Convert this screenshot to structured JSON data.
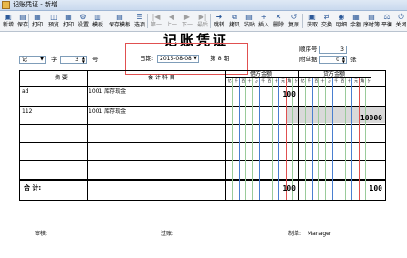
{
  "window": {
    "title": "记账凭证 - 新增"
  },
  "toolbar": {
    "buttons": [
      {
        "label": "新增",
        "icon": "new-icon",
        "glyph": "▣",
        "enabled": true
      },
      {
        "label": "保存",
        "icon": "save-icon",
        "glyph": "▤",
        "enabled": true
      },
      {
        "label": "打印",
        "icon": "print-icon",
        "glyph": "▦",
        "enabled": true
      },
      {
        "label": "预览",
        "icon": "preview-icon",
        "glyph": "◫",
        "enabled": true
      },
      {
        "label": "打印",
        "icon": "print2-icon",
        "glyph": "▦",
        "enabled": true
      },
      {
        "label": "设置",
        "icon": "settings-icon",
        "glyph": "⚙",
        "enabled": true
      },
      {
        "label": "模板",
        "icon": "template-icon",
        "glyph": "▥",
        "enabled": true
      },
      {
        "label": "保存模板",
        "icon": "save-template-icon",
        "glyph": "▤",
        "enabled": true
      },
      {
        "label": "选项",
        "icon": "options-icon",
        "glyph": "☰",
        "enabled": true
      },
      {
        "label": "第一",
        "icon": "first-icon",
        "glyph": "|◀",
        "enabled": false
      },
      {
        "label": "上一",
        "icon": "prev-icon",
        "glyph": "◀",
        "enabled": false
      },
      {
        "label": "下一",
        "icon": "next-icon",
        "glyph": "▶",
        "enabled": false
      },
      {
        "label": "最后",
        "icon": "last-icon",
        "glyph": "▶|",
        "enabled": false
      },
      {
        "label": "跳转",
        "icon": "jump-icon",
        "glyph": "➜",
        "enabled": true
      },
      {
        "label": "拷贝",
        "icon": "copy-icon",
        "glyph": "⧉",
        "enabled": true
      },
      {
        "label": "粘贴",
        "icon": "paste-icon",
        "glyph": "▤",
        "enabled": true
      },
      {
        "label": "插入",
        "icon": "insert-icon",
        "glyph": "+",
        "enabled": true
      },
      {
        "label": "删除",
        "icon": "delete-icon",
        "glyph": "✕",
        "enabled": true
      },
      {
        "label": "复原",
        "icon": "restore-icon",
        "glyph": "↺",
        "enabled": true
      },
      {
        "label": "获取",
        "icon": "fetch-icon",
        "glyph": "▣",
        "enabled": true
      },
      {
        "label": "交换",
        "icon": "swap-icon",
        "glyph": "⇄",
        "enabled": true
      },
      {
        "label": "明细",
        "icon": "detail-icon",
        "glyph": "◉",
        "enabled": true
      },
      {
        "label": "余额",
        "icon": "balance-icon",
        "glyph": "▦",
        "enabled": true
      },
      {
        "label": "序时簿",
        "icon": "journal-icon",
        "glyph": "▤",
        "enabled": true
      },
      {
        "label": "平衡",
        "icon": "balance-check-icon",
        "glyph": "⚖",
        "enabled": true
      },
      {
        "label": "关闭",
        "icon": "close-icon",
        "glyph": "⏻",
        "enabled": true
      }
    ]
  },
  "voucher": {
    "title": "记账凭证",
    "type_value": "记",
    "zi_label": "字",
    "number_value": "3",
    "hao_label": "号",
    "date_label": "日期:",
    "date_value": "2015-08-08",
    "period_label": "第 8 期",
    "seq_label": "顺序号",
    "seq_value": "3",
    "attach_label": "附单据",
    "attach_value": "0",
    "zhang_label": "张"
  },
  "table": {
    "col_summary": "摘  要",
    "col_account": "会 计 科 目",
    "col_debit": "借方金额",
    "col_credit": "贷方金额",
    "digit_headers": [
      "亿",
      "千",
      "百",
      "十",
      "万",
      "千",
      "百",
      "十",
      "元",
      "角",
      "分"
    ],
    "rows": [
      {
        "summary": "ad",
        "account": "1001 库存现金",
        "debit": "100",
        "credit": ""
      },
      {
        "summary": "112",
        "account": "1001 库存现金",
        "debit": "",
        "credit": "10000"
      },
      {
        "summary": "",
        "account": "",
        "debit": "",
        "credit": ""
      },
      {
        "summary": "",
        "account": "",
        "debit": "",
        "credit": ""
      }
    ],
    "total_label": "合  计:",
    "total_debit": "100",
    "total_credit": "100"
  },
  "footer": {
    "auditor_label": "审核:",
    "poster_label": "过账:",
    "maker_label": "制单:",
    "maker_value": "Manager"
  }
}
